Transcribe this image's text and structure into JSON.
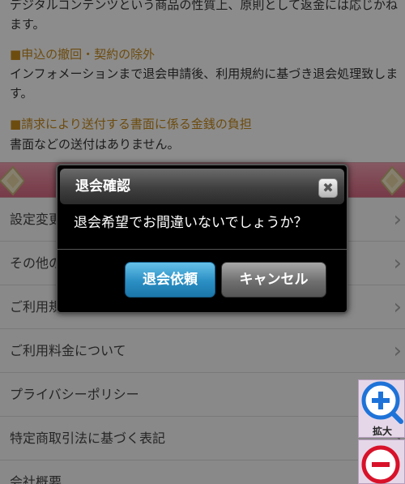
{
  "notice": {
    "line1": "デジタルコンテンツという商品の性質上、原則として返金には応じかねます。",
    "heading1": "■申込の撤回・契約の除外",
    "text1": "インフォメーションまで退会申請後、利用規約に基づき退会処理致します。",
    "heading2": "■請求により送付する書面に係る金銭の負担",
    "text2": "書面などの送付はありません。"
  },
  "menu": {
    "items": [
      {
        "label": "設定変更"
      },
      {
        "label": "その他の"
      },
      {
        "label": "ご利用規"
      },
      {
        "label": "ご利用料金について"
      },
      {
        "label": "プライバシーポリシー"
      },
      {
        "label": "特定商取引法に基づく表記"
      },
      {
        "label": "会社概要"
      }
    ]
  },
  "dialog": {
    "title": "退会確認",
    "message": "退会希望でお間違いないでしょうか？",
    "confirm_label": "退会依頼",
    "cancel_label": "キャンセル",
    "close_glyph": "✖"
  },
  "zoom": {
    "zoom_in_label": "拡大",
    "zoom_in_icon": "zoom-in-icon",
    "zoom_out_icon": "zoom-out-icon",
    "accent": "#1e73d8",
    "minus_accent": "#d8122a"
  },
  "colors": {
    "heading": "#c78a1c",
    "banner": "#e57f95",
    "confirm_button": "#2a8fc4"
  }
}
